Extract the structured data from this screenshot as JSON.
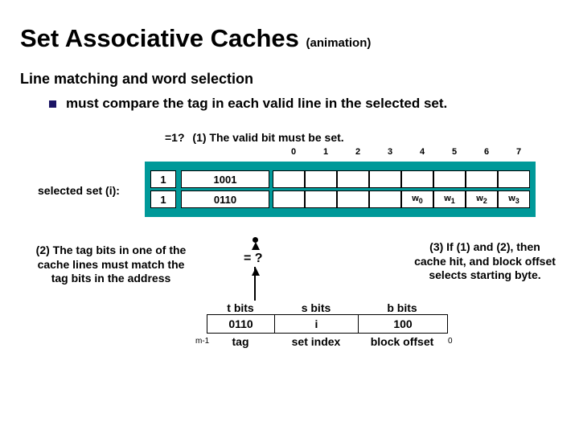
{
  "title": "Set Associative Caches",
  "title_anim": "(animation)",
  "subtitle": "Line matching and word selection",
  "bullet": "must compare the tag in each valid line in the selected set.",
  "step1_q": "=1?",
  "step1": "(1) The valid bit must be set.",
  "col_labels": [
    "0",
    "1",
    "2",
    "3",
    "4",
    "5",
    "6",
    "7"
  ],
  "rows": [
    {
      "valid": "1",
      "tag": "1001",
      "blocks": [
        "",
        "",
        "",
        "",
        "",
        "",
        "",
        ""
      ]
    },
    {
      "valid": "1",
      "tag": "0110",
      "blocks": [
        "",
        "",
        "",
        "",
        "w0",
        "w1",
        "w2",
        "w3"
      ]
    }
  ],
  "selset_label": "selected set (i):",
  "step2": "(2) The tag bits in one of the cache lines must match the tag bits in the address",
  "step3": "(3) If (1) and (2), then cache hit, and block offset selects starting byte.",
  "eq_q": "= ?",
  "addr": {
    "hdr": [
      "t bits",
      "s bits",
      "b bits"
    ],
    "val": [
      "0110",
      "i",
      "100"
    ],
    "lbl": [
      "tag",
      "set index",
      "block offset"
    ]
  },
  "m1": "m-1",
  "m0": "0"
}
